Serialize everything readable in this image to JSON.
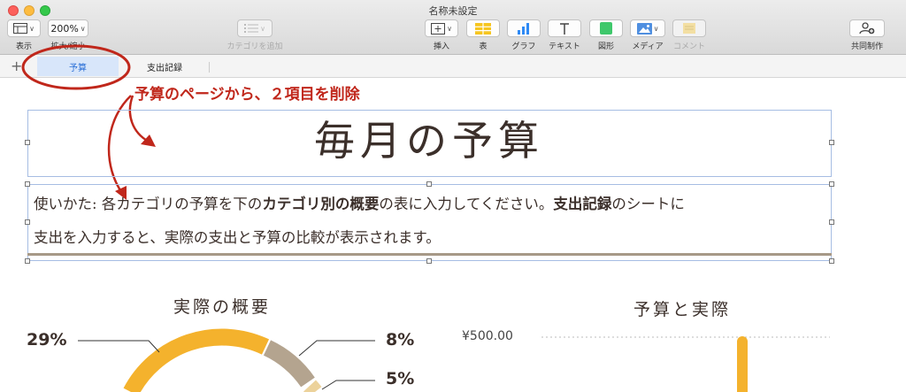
{
  "window": {
    "title": "名称未設定"
  },
  "toolbar": {
    "view_label": "表示",
    "zoom_value": "200%",
    "zoom_label": "拡大/縮小",
    "category_label": "カテゴリを追加",
    "insert_label": "挿入",
    "table_label": "表",
    "chart_label": "グラフ",
    "text_label": "テキスト",
    "shape_label": "図形",
    "media_label": "メディア",
    "comment_label": "コメント",
    "collab_label": "共同制作"
  },
  "tabs": [
    {
      "label": "予算"
    },
    {
      "label": "支出記録"
    }
  ],
  "annotation": {
    "text": "予算のページから、２項目を削除"
  },
  "document": {
    "title": "毎月の予算",
    "body_1": "使いかた: 各カテゴリの予算を下の",
    "body_bold_1": "カテゴリ別の概要",
    "body_2": "の表に入力してください。",
    "body_bold_2": "支出記録",
    "body_3": "のシートに",
    "body_4": "支出を入力すると、実際の支出と予算の比較が表示されます。"
  },
  "donut_chart": {
    "title": "実際の概要",
    "labels": [
      "29%",
      "8%",
      "5%"
    ]
  },
  "bar_chart": {
    "title": "予算と実際",
    "y_tick": "¥500.00"
  },
  "colors": {
    "accent_blue": "#2a6fd6",
    "annotation_red": "#c0271b",
    "donut_orange": "#f4b22d",
    "donut_taupe": "#b4a48f",
    "donut_cream": "#ecd29b"
  }
}
